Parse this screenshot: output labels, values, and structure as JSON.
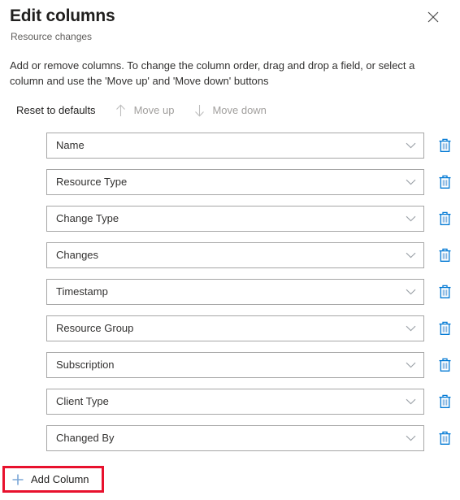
{
  "panel": {
    "title": "Edit columns",
    "subtitle": "Resource changes",
    "description": "Add or remove columns. To change the column order, drag and drop a field, or select a column and use the 'Move up' and 'Move down' buttons",
    "close_icon": "close-icon"
  },
  "command_bar": {
    "reset": {
      "label": "Reset to defaults",
      "enabled": true,
      "icon": ""
    },
    "move_up": {
      "label": "Move up",
      "enabled": false,
      "icon": "arrow-up-icon"
    },
    "move_down": {
      "label": "Move down",
      "enabled": false,
      "icon": "arrow-down-icon"
    }
  },
  "columns": [
    {
      "value": "Name",
      "chevron_icon": "chevron-down-icon",
      "delete_icon": "trash-icon"
    },
    {
      "value": "Resource Type",
      "chevron_icon": "chevron-down-icon",
      "delete_icon": "trash-icon"
    },
    {
      "value": "Change Type",
      "chevron_icon": "chevron-down-icon",
      "delete_icon": "trash-icon"
    },
    {
      "value": "Changes",
      "chevron_icon": "chevron-down-icon",
      "delete_icon": "trash-icon"
    },
    {
      "value": "Timestamp",
      "chevron_icon": "chevron-down-icon",
      "delete_icon": "trash-icon"
    },
    {
      "value": "Resource Group",
      "chevron_icon": "chevron-down-icon",
      "delete_icon": "trash-icon"
    },
    {
      "value": "Subscription",
      "chevron_icon": "chevron-down-icon",
      "delete_icon": "trash-icon"
    },
    {
      "value": "Client Type",
      "chevron_icon": "chevron-down-icon",
      "delete_icon": "trash-icon"
    },
    {
      "value": "Changed By",
      "chevron_icon": "chevron-down-icon",
      "delete_icon": "trash-icon"
    }
  ],
  "add_column": {
    "label": "Add Column",
    "icon": "plus-icon",
    "highlight": true
  },
  "colors": {
    "accent_blue": "#0078d4",
    "plus_blue": "#7ba7d7",
    "highlight_red": "#e8112d",
    "border_gray": "#a6a6a6",
    "disabled_gray": "#a19f9d",
    "text_primary": "#201f1e",
    "text_secondary": "#605e5c"
  }
}
